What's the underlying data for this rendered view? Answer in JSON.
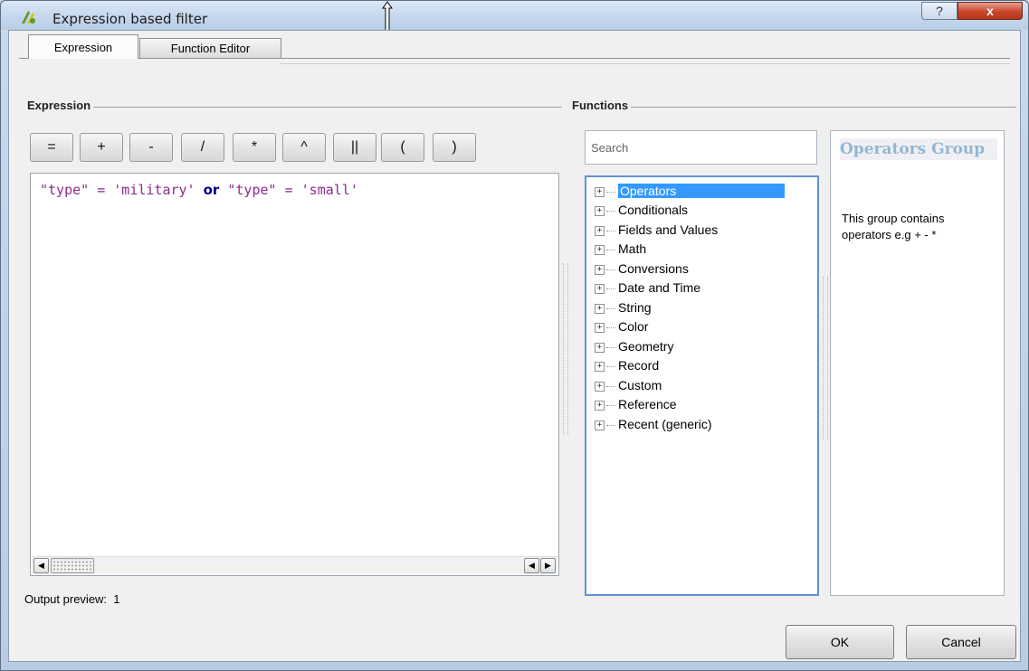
{
  "window": {
    "title": "Expression based filter",
    "help_glyph": "?",
    "close_glyph": "x"
  },
  "tabs": [
    "Expression",
    "Function Editor"
  ],
  "expression_group": {
    "title": "Expression",
    "operators": [
      "=",
      "+",
      "-",
      "/",
      "*",
      "^",
      "||",
      "(",
      ")"
    ],
    "code": {
      "part1": "\"type\" = 'military'",
      "keyword": "or",
      "part2": "\"type\" = 'small'"
    },
    "scroll_left": "◀",
    "scroll_right": "▶",
    "preview_label": "Output preview:",
    "preview_value": "1"
  },
  "functions_group": {
    "title": "Functions",
    "search_placeholder": "Search",
    "expand_glyph": "+",
    "items": [
      "Operators",
      "Conditionals",
      "Fields and Values",
      "Math",
      "Conversions",
      "Date and Time",
      "String",
      "Color",
      "Geometry",
      "Record",
      "Custom",
      "Reference",
      "Recent (generic)"
    ],
    "selected_index": 0,
    "help_title": "Operators Group",
    "help_body": "This group contains operators e.g + - *"
  },
  "buttons": {
    "ok": "OK",
    "cancel": "Cancel"
  }
}
